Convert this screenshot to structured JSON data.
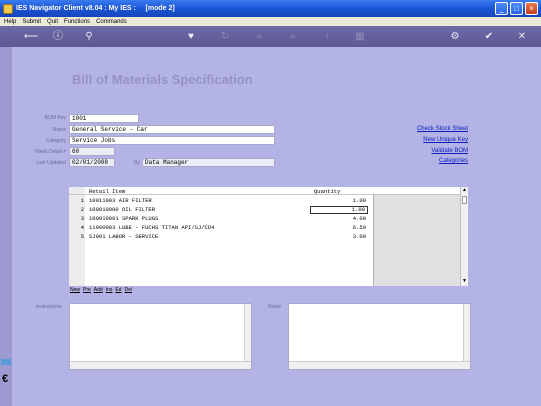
{
  "window": {
    "title": "IES Navigator Client v8.04 : My IES :     [mode 2]"
  },
  "menu": [
    "Help",
    "Submit",
    "Quit",
    "Functions",
    "Commands"
  ],
  "toolbar_icons": [
    "back-arrow-icon",
    "info-icon",
    "search-icon",
    "heart-icon",
    "refresh-icon",
    "first-icon",
    "last-icon",
    "up-icon",
    "grid-icon",
    "gear-icon",
    "check-icon",
    "close-icon"
  ],
  "page": {
    "title": "Bill of Materials Specification"
  },
  "form": {
    "bom_key_label": "BOM Key",
    "bom_key": "1001",
    "name_label": "Name",
    "name": "General Service - Car",
    "category_label": "Category",
    "category": "Service Jobs",
    "week_detail_label": "Week Detail #",
    "week_detail": "60",
    "last_updated_label": "Last Updated",
    "last_updated": "02/01/2008",
    "by_label": "By",
    "by": "Data Manager"
  },
  "links": {
    "check_stock": "Check Stock Sheet",
    "new_unique_key": "New Unique Key",
    "validate_bom": "Validate BOM",
    "categories": "Categories"
  },
  "grid": {
    "col_item": "Retail Item",
    "col_qty": "Quantity",
    "rows": [
      {
        "num": "1",
        "item": "10011003 AIR FILTER",
        "qty": "1.00"
      },
      {
        "num": "2",
        "item": "100010000 OIL FILTER",
        "qty": "1.00"
      },
      {
        "num": "3",
        "item": "100010001 SPARK PLUGS",
        "qty": "4.00"
      },
      {
        "num": "4",
        "item": "11000003 LUBE - FUCHS TITAN API/SJ/CD4",
        "qty": "6.50"
      },
      {
        "num": "5",
        "item": "SJ001 LABOR - SERVICE",
        "qty": "3.00"
      }
    ]
  },
  "grid_buttons": {
    "new": "New",
    "pre": "Pre",
    "add": "Add",
    "ins": "Ins",
    "ed": "Ed",
    "del": "Del"
  },
  "memos": {
    "instructions_label": "Instructions",
    "notes_label": "Notes"
  }
}
